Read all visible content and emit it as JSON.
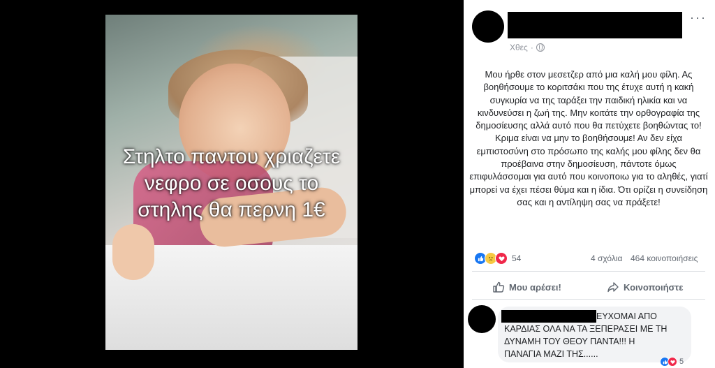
{
  "photo": {
    "overlay_lines": [
      "Στηλτο παντου χριαζετε",
      "νεφρο σε οσους το",
      "στηλης θα περνη 1€"
    ]
  },
  "post": {
    "timestamp": "Χθες",
    "separator": "·",
    "privacy_icon": "globe-icon",
    "more_label": "···",
    "text": "Μου ήρθε στον μεσετζερ από μια καλή μου φίλη. Ας βοηθήσουμε το κοριτσάκι που της έτυχε αυτή η κακή συγκυρία να της ταράξει την παιδική ηλικία και να κινδυνεύσει η ζωή της. Μην κοιτάτε την ορθογραφία της δημοσίευσης αλλά αυτό που θα πετύχετε βοηθώντας το! Κριμα είναι να μην το βοηθήσουμε! Αν δεν είχα εμπιστοσύνη στο πρόσωπο της καλής μου φίλης δεν θα προέβαινα στην δημοσίευση, πάντοτε όμως επιφυλάσσομαι για αυτό που κοινοποιω για το αληθές, γιατί μπορεί να έχει πέσει θύμα και η ίδια. Ότι ορίζει η συνείδηση σας και η αντίληψη σας να πράξετε!",
    "reactions": {
      "icons": [
        "like-icon",
        "sad-icon",
        "love-icon"
      ],
      "count": "54"
    },
    "comments_count": "4 σχόλια",
    "shares_count": "464 κοινοποιήσεις",
    "actions": {
      "like_label": "Μου αρέσει!",
      "share_label": "Κοινοποιήστε"
    }
  },
  "comment": {
    "line1": "ΕΥΧΟΜΑΙ ΑΠΟ",
    "line2": "ΚΑΡΔΙΑΣ ΟΛΑ ΝΑ ΤΑ ΞΕΠΕΡΑΣΕΙ ΜΕ ΤΗ",
    "line3": "ΔΥΝΑΜΗ ΤΟΥ ΘΕΟΥ ΠΑΝΤΑ!!! Η",
    "line4": "ΠΑΝΑΓΙΑ ΜΑΖΙ ΤΗΣ......",
    "reaction_count": "5"
  },
  "colors": {
    "accent": "#1877f2",
    "text": "#1c1e21",
    "muted": "#606770"
  }
}
